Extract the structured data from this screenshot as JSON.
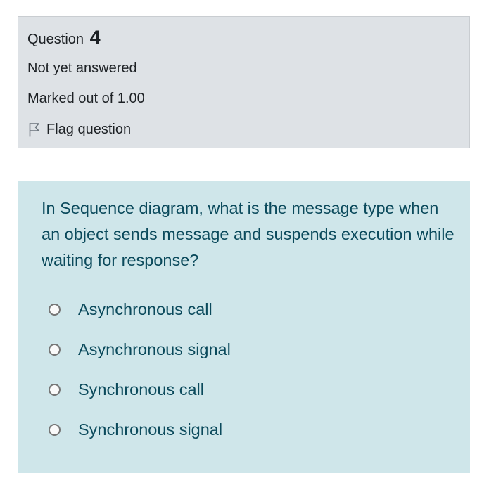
{
  "info": {
    "question_prefix": "Question",
    "question_number": "4",
    "state": "Not yet answered",
    "grade": "Marked out of 1.00",
    "flag_label": "Flag question",
    "flag_icon": "flag-outline-icon"
  },
  "question": {
    "text": "In Sequence diagram, what is the message type when an object sends message and suspends execution while waiting for response?",
    "options": [
      {
        "label": "Asynchronous call",
        "selected": false
      },
      {
        "label": "Asynchronous signal",
        "selected": false
      },
      {
        "label": "Synchronous call",
        "selected": false
      },
      {
        "label": "Synchronous signal",
        "selected": false
      }
    ]
  },
  "colors": {
    "info_background": "#dee2e6",
    "question_background": "#cfe6ea",
    "question_text": "#0b4a5c"
  }
}
